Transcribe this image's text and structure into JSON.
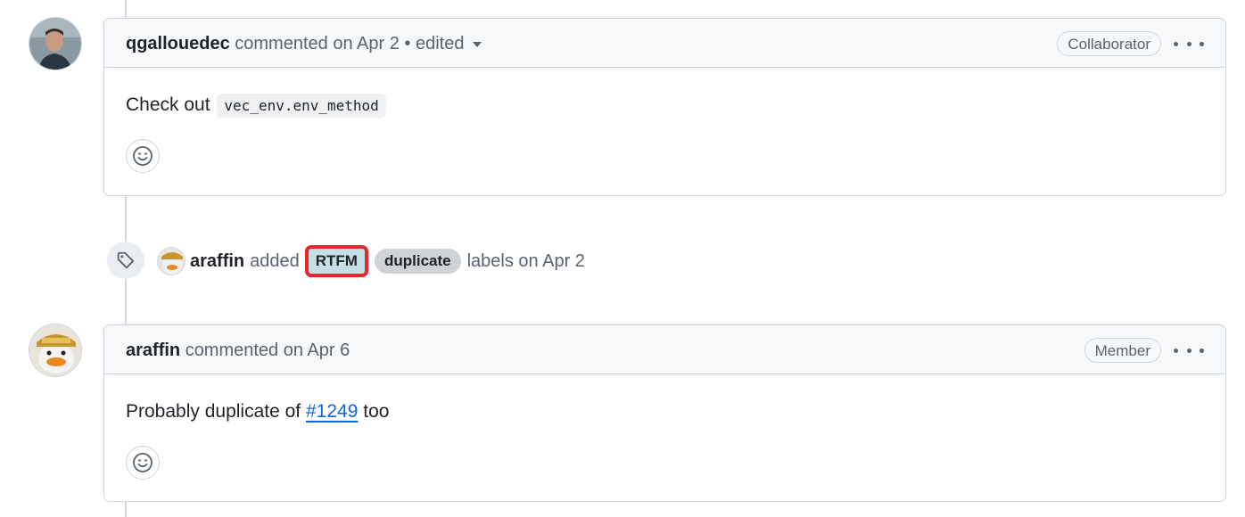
{
  "colors": {
    "accent_link": "#0969da",
    "label_rtfm_bg": "#c5dfe4",
    "label_duplicate_bg": "#cfd3d7",
    "highlight_box": "#e5292f"
  },
  "comments": [
    {
      "author": "qgallouedec",
      "action": "commented on Apr 2",
      "edited": "• edited",
      "role": "Collaborator",
      "body_prefix": "Check out",
      "body_code": "vec_env.env_method",
      "reaction_icon": "smiley-icon"
    },
    {
      "author": "araffin",
      "action": "commented on Apr 6",
      "role": "Member",
      "body_prefix": "Probably duplicate of",
      "body_link": "#1249",
      "body_suffix": "too",
      "reaction_icon": "smiley-icon"
    }
  ],
  "label_event": {
    "icon": "tag-icon",
    "author": "araffin",
    "verb": "added",
    "labels": [
      "RTFM",
      "duplicate"
    ],
    "suffix": "labels on Apr 2"
  }
}
